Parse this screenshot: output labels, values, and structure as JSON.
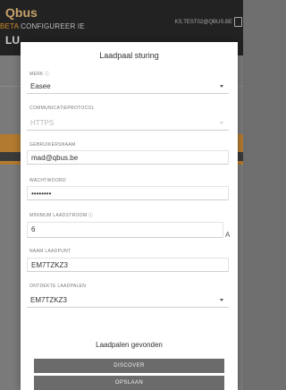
{
  "header": {
    "logo": "Qbus",
    "beta": "BETA",
    "configure": "CONFIGUREER IE",
    "page_title": "LU",
    "user": "KS.TEST02@QBUS.BE"
  },
  "modal": {
    "title": "Laadpaal sturing",
    "fields": [
      {
        "label": "MERK ⓘ",
        "value": "Easee"
      },
      {
        "label": "COMMUNICATIEPROTOCOL",
        "value": "HTTPS"
      },
      {
        "label": "GEBRUIKERSNAAM",
        "value": "mad@qbus.be"
      },
      {
        "label": "WACHTWOORD",
        "value": "••••••••"
      },
      {
        "label": "MINIMUM LAADSTROOM ⓘ",
        "value": "6",
        "unit": "A"
      },
      {
        "label": "NAAM LAADPUNT",
        "value": "EM7TZKZ3"
      },
      {
        "label": "ONTDEKTE LAADPALEN",
        "value": "EM7TZKZ3"
      }
    ],
    "status": "Laadpalen gevonden",
    "discover_label": "DISCOVER",
    "save_label": "OPSLAAN"
  }
}
